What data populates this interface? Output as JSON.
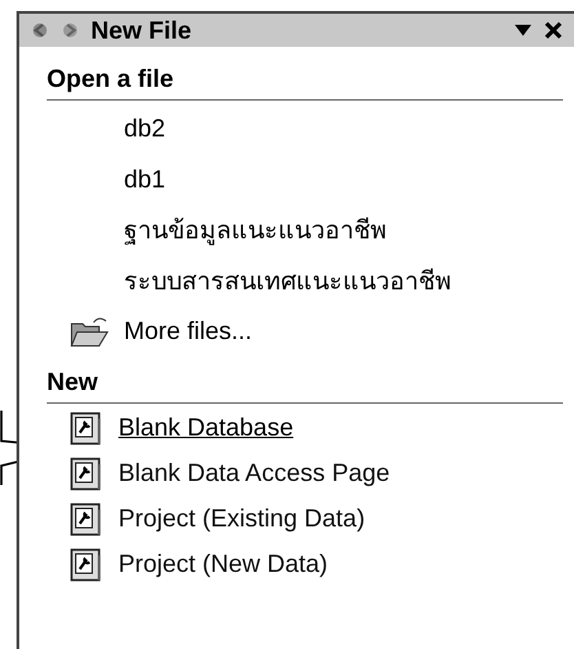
{
  "task_pane": {
    "title": "New File"
  },
  "open_section": {
    "heading": "Open a file",
    "files": [
      "db2",
      "db1",
      "ฐานข้อมูลแนะแนวอาชีพ",
      "ระบบสารสนเทศแนะแนวอาชีพ"
    ],
    "more_files": "More files..."
  },
  "new_section": {
    "heading": "New",
    "items": [
      {
        "label": "Blank Database",
        "hovered": true
      },
      {
        "label": "Blank Data Access Page",
        "hovered": false
      },
      {
        "label": "Project (Existing Data)",
        "hovered": false
      },
      {
        "label": "Project (New Data)",
        "hovered": false
      }
    ]
  }
}
